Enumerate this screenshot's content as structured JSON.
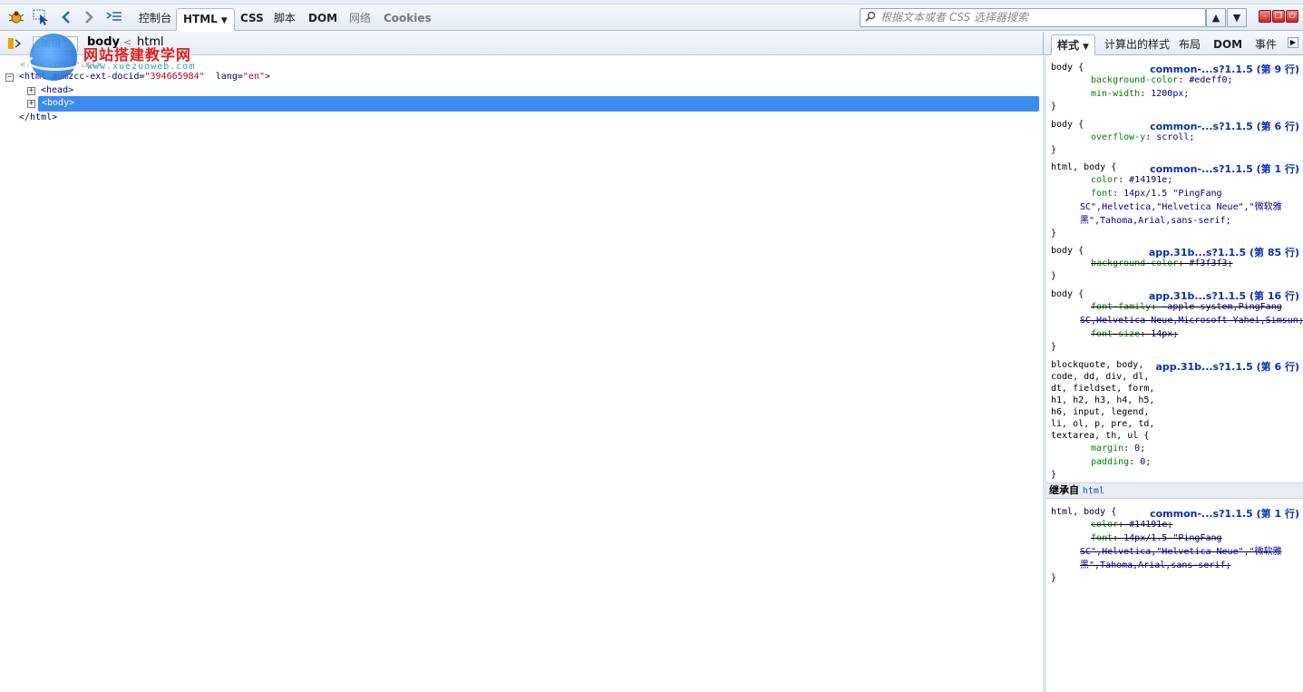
{
  "toolbar": {
    "tabs": [
      "控制台",
      "HTML",
      "CSS",
      "脚本",
      "DOM",
      "网络",
      "Cookies"
    ],
    "active_tab": "HTML",
    "search_placeholder": "根据文本或者 CSS 选择器搜索",
    "up_glyph": "▲",
    "down_glyph": "▼"
  },
  "breadcrumb": {
    "current": "body",
    "separator": "<",
    "parent": "html",
    "edit_label": "编辑"
  },
  "watermark": {
    "title": "网站搭建教学网",
    "url": "www.xuezuoweb.com"
  },
  "tree": {
    "doctype": "<!DOCTYPE html>",
    "html_open": "<html",
    "attr1_name": "admzcc-ext-docid",
    "attr1_value": "\"394665984\"",
    "attr2_name": "lang",
    "attr2_value": "\"en\"",
    "head": "<head>",
    "body": "<body>",
    "html_close": "</html>"
  },
  "sidepanel": {
    "tabs": [
      "样式",
      "计算出的样式",
      "布局",
      "DOM",
      "事件"
    ],
    "active_tab": "样式",
    "inherited_label": "继承自",
    "inherited_from": "html"
  },
  "rules": [
    {
      "selector": "body {",
      "source": "common-...s?1.1.5 (第 9 行)",
      "props": [
        {
          "name": "background-color",
          "value": "#edeff0;",
          "over": false
        },
        {
          "name": "min-width",
          "value": "1200px;",
          "over": false
        }
      ]
    },
    {
      "selector": "body {",
      "source": "common-...s?1.1.5 (第 6 行)",
      "props": [
        {
          "name": "overflow-y",
          "value": "scroll;",
          "over": false
        }
      ]
    },
    {
      "selector": "html, body {",
      "source": "common-...s?1.1.5 (第 1 行)",
      "props": [
        {
          "name": "color",
          "value": "#14191e;",
          "over": false
        },
        {
          "name": "font",
          "value": "14px/1.5 \"PingFang",
          "over": false
        }
      ],
      "wrap": [
        "SC\",Helvetica,\"Helvetica Neue\",\"微软雅",
        "黑\",Tahoma,Arial,sans-serif;"
      ]
    },
    {
      "selector": "body {",
      "source": "app.31b...s?1.1.5 (第 85 行)",
      "props": [
        {
          "name": "background-color",
          "value": "#f3f3f3;",
          "over": true
        }
      ]
    },
    {
      "selector": "body {",
      "source": "app.31b...s?1.1.5 (第 16 行)",
      "props": [
        {
          "name": "font-family",
          "value": "-apple-system,PingFang",
          "over": true
        }
      ],
      "wrap_over": "SC,Helvetica Neue,Microsoft Yahei,Simsun;",
      "props2": [
        {
          "name": "font-size",
          "value": "14px;",
          "over": true
        }
      ]
    },
    {
      "selector_lines": [
        "blockquote, body,",
        "code, dd, div, dl,",
        "dt, fieldset, form,",
        "h1, h2, h3, h4, h5,",
        "h6, input, legend,",
        "li, ol, p, pre, td,",
        "textarea, th, ul {"
      ],
      "source": "app.31b...s?1.1.5 (第 6 行)",
      "props": [
        {
          "name": "margin",
          "value": "0;",
          "over": false
        },
        {
          "name": "padding",
          "value": "0;",
          "over": false
        }
      ]
    }
  ],
  "inherited_rule": {
    "selector": "html, body {",
    "source": "common-...s?1.1.5 (第 1 行)",
    "props": [
      {
        "name": "color",
        "value": "#14191e;",
        "over": true
      },
      {
        "name": "font",
        "value": "14px/1.5 \"PingFang",
        "over": true
      }
    ],
    "wrap": [
      "SC\",Helvetica,\"Helvetica Neue\",\"微软雅",
      "黑\",Tahoma,Arial,sans-serif;"
    ]
  }
}
